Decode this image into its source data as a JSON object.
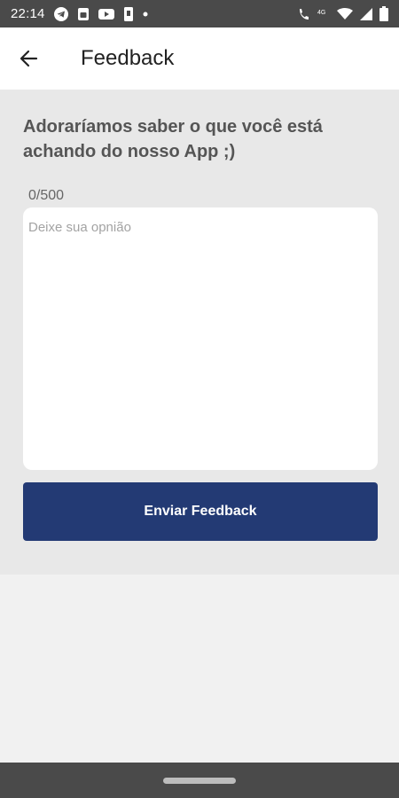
{
  "status_bar": {
    "time": "22:14",
    "icons_left": [
      "telegram-icon",
      "sim-icon",
      "youtube-icon",
      "phone-icon",
      "dot-icon"
    ],
    "icons_right": [
      "call-icon",
      "4g-icon",
      "wifi-icon",
      "signal-icon",
      "battery-icon"
    ],
    "network_label": "4G"
  },
  "app_bar": {
    "back_icon": "arrow-left-icon",
    "title": "Feedback"
  },
  "main": {
    "headline": "Adoraríamos saber o que você está achando do nosso App ;)",
    "counter": "0/500",
    "input_value": "",
    "input_placeholder": "Deixe sua opnião",
    "submit_label": "Enviar Feedback"
  },
  "colors": {
    "primary": "#233a74",
    "status_bar": "#4a4a4a",
    "content_bg": "#e8e8e8",
    "page_bg": "#f1f1f1"
  }
}
